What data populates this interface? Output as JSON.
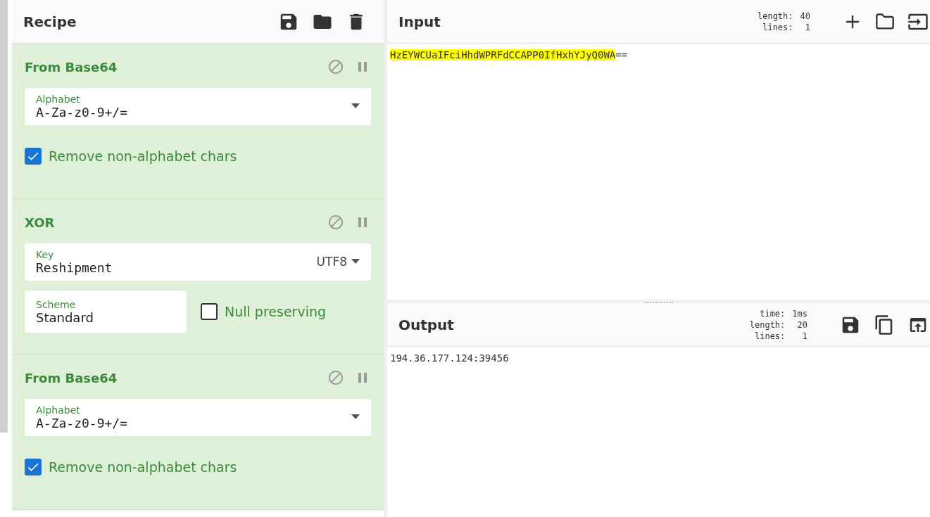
{
  "recipe": {
    "title": "Recipe",
    "operations": [
      {
        "name": "From Base64",
        "disabled": false,
        "paused": false,
        "rows": [
          [
            {
              "kind": "select",
              "label": "Alphabet",
              "value": "A-Za-z0-9+/="
            }
          ],
          [
            {
              "kind": "checkbox",
              "label": "Remove non-alphabet chars",
              "checked": true
            }
          ]
        ]
      },
      {
        "name": "XOR",
        "disabled": false,
        "paused": false,
        "rows": [
          [
            {
              "kind": "keyed",
              "label": "Key",
              "value": "Reshipment",
              "option": "UTF8"
            }
          ],
          [
            {
              "kind": "text",
              "label": "Scheme",
              "value": "Standard"
            },
            {
              "kind": "checkbox",
              "label": "Null preserving",
              "checked": false
            }
          ]
        ]
      },
      {
        "name": "From Base64",
        "disabled": false,
        "paused": false,
        "rows": [
          [
            {
              "kind": "select",
              "label": "Alphabet",
              "value": "A-Za-z0-9+/="
            }
          ],
          [
            {
              "kind": "checkbox",
              "label": "Remove non-alphabet chars",
              "checked": true
            }
          ]
        ]
      }
    ]
  },
  "input": {
    "title": "Input",
    "stats": [
      {
        "label": "length:",
        "value": "40"
      },
      {
        "label": "lines:",
        "value": "1"
      }
    ],
    "highlighted": "HzEYWCUaIFciHhdWPRFdCCAPP0IfHxhYJyQ0WA",
    "rest": "=="
  },
  "output": {
    "title": "Output",
    "stats": [
      {
        "label": "time:",
        "value": "1ms"
      },
      {
        "label": "length:",
        "value": "20"
      },
      {
        "label": "lines:",
        "value": "1"
      }
    ],
    "text": "194.36.177.124:39456"
  }
}
